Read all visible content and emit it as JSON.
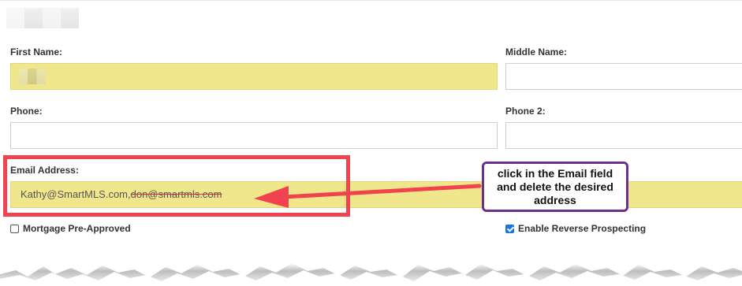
{
  "form": {
    "first_name": {
      "label": "First Name:"
    },
    "middle_name": {
      "label": "Middle Name:",
      "value": ""
    },
    "phone": {
      "label": "Phone:",
      "value": ""
    },
    "phone2": {
      "label": "Phone 2:",
      "value": ""
    },
    "email": {
      "label": "Email Address:",
      "value_kept": "Kathy@SmartMLS.com,",
      "value_struck": "don@smartmls.com"
    },
    "mortgage": {
      "label": "Mortgage Pre-Approved",
      "checked": false
    },
    "reverse": {
      "label": "Enable Reverse Prospecting",
      "checked": true
    }
  },
  "annotation": {
    "callout_text": "click in the Email field and delete the desired address",
    "box_color": "#f0434f",
    "callout_border_color": "#6b2f8e"
  },
  "colors": {
    "field_highlight": "#f0e68c",
    "checkbox_checked": "#1a73e8"
  }
}
